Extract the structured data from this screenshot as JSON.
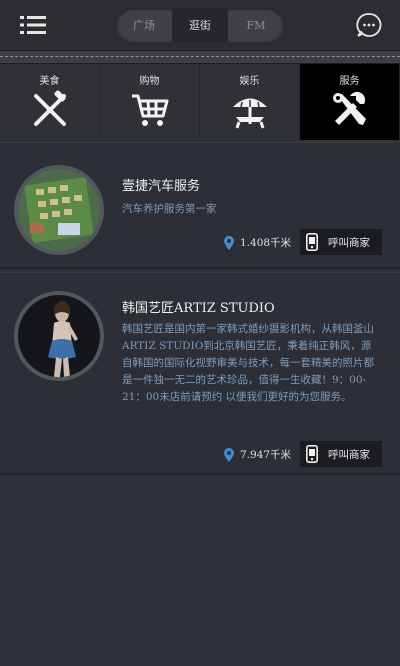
{
  "header": {
    "tabs": [
      {
        "label": "广场",
        "active": false
      },
      {
        "label": "逛街",
        "active": true
      },
      {
        "label": "FM",
        "active": false
      }
    ]
  },
  "categories": [
    {
      "label": "美食",
      "icon": "utensils-icon",
      "active": false
    },
    {
      "label": "购物",
      "icon": "shopping-cart-icon",
      "active": false
    },
    {
      "label": "娱乐",
      "icon": "beach-umbrella-icon",
      "active": false
    },
    {
      "label": "服务",
      "icon": "tools-icon",
      "active": true
    }
  ],
  "listings": [
    {
      "title": "壹捷汽车服务",
      "description": "汽车养护服务第一家",
      "distance": "1.408千米",
      "call_label": "呼叫商家"
    },
    {
      "title": "韩国艺匠ARTIZ STUDIO",
      "description": "韩国艺匠是国内第一家韩式婚纱摄影机构，从韩国釜山ARTIZ STUDIO到北京韩国艺匠，秉着纯正韩风，源自韩国的国际化视野审美与技术，每一套精美的照片都是一件独一无二的艺术珍品，值得一生收藏！9：00-21：00未店前请预约 以便我们更好的为您服务。",
      "distance": "7.947千米",
      "call_label": "呼叫商家"
    }
  ],
  "colors": {
    "accent_blue": "#3f8fd6",
    "desc_text": "#7d9bb8",
    "active_category_bg": "#000000"
  }
}
